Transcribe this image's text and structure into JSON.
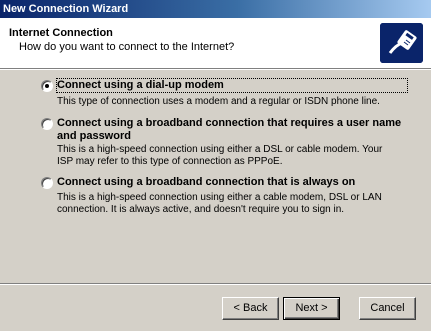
{
  "window": {
    "title": "New Connection Wizard"
  },
  "header": {
    "title": "Internet Connection",
    "subtitle": "How do you want to connect to the Internet?",
    "icon": "network-cable-icon"
  },
  "options": [
    {
      "label": "Connect using a dial-up modem",
      "description": "This type of connection uses a modem and a regular or ISDN phone line.",
      "selected": true
    },
    {
      "label": "Connect using a broadband connection that requires a user name and password",
      "description": "This is a high-speed connection using either a DSL or cable modem. Your ISP may refer to this type of connection as PPPoE.",
      "selected": false
    },
    {
      "label": "Connect using a broadband connection that is always on",
      "description": "This is a high-speed connection using either a cable modem, DSL or LAN connection. It is always active, and doesn't require you to sign in.",
      "selected": false
    }
  ],
  "buttons": {
    "back": "< Back",
    "next": "Next >",
    "cancel": "Cancel"
  }
}
